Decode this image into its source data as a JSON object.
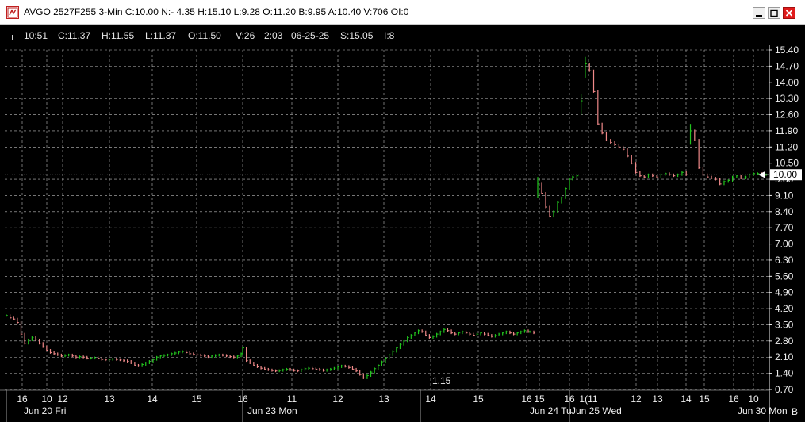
{
  "window": {
    "title": "AVGO 2527F255 3-Min C:10.00 N:- 4.35 H:15.10 L:9.28 O:11.20 B:9.95 A:10.40 V:706 OI:0",
    "icon": "chart-app-icon",
    "controls": [
      "minimize-icon",
      "maximize-icon",
      "close-icon"
    ]
  },
  "infobar": {
    "time": "10:51",
    "close": "C:11.37",
    "high": "H:11.55",
    "low": "L:11.37",
    "open": "O:11.50",
    "volume": "V:26",
    "bar_time": "2:03",
    "date": "06-25-25",
    "strike": "S:15.05",
    "index": "I:8"
  },
  "colors": {
    "background": "#000000",
    "grid": "#bdbdbd",
    "up": "#22c41e",
    "down": "#f08a8a",
    "text": "#f0f0f0",
    "price_box": "#ffffff"
  },
  "chart_data": {
    "type": "line",
    "title": "",
    "xlabel": "",
    "ylabel": "",
    "ylim": [
      0.7,
      15.4
    ],
    "y_ticks": [
      "15.40",
      "14.70",
      "14.00",
      "13.30",
      "12.60",
      "11.90",
      "11.20",
      "10.50",
      "9.80",
      "9.10",
      "8.40",
      "7.70",
      "7.00",
      "6.30",
      "5.60",
      "4.90",
      "4.20",
      "3.50",
      "2.80",
      "2.10",
      "1.40",
      "0.70"
    ],
    "current_price": "10.00",
    "low_label": "1.15",
    "x_tick_labels": [
      "16",
      "10",
      "12",
      "13",
      "14",
      "15",
      "16",
      "11",
      "12",
      "13",
      "14",
      "15",
      "16",
      "15",
      "16",
      "1(11",
      "12",
      "13",
      "14",
      "15",
      "16",
      "10"
    ],
    "date_labels": [
      "Jun 20 Fri",
      "Jun 23 Mon",
      "Jun 24 Tu",
      "Jun 25 Wed",
      "Jun 30 Mon"
    ],
    "corner_label": "B",
    "series": [
      {
        "values": [
          3.9,
          3.8,
          3.75,
          3.6,
          3.1,
          2.7,
          2.85,
          2.95,
          2.85,
          2.7,
          2.55,
          2.4,
          2.3,
          2.25,
          2.2,
          2.15,
          2.18,
          2.2,
          2.15,
          2.1,
          2.12,
          2.1,
          2.05,
          2.05,
          2.08,
          2.05,
          2.0,
          1.98,
          2.0,
          2.02,
          2.0,
          1.98,
          1.95,
          1.92,
          1.85,
          1.75,
          1.72,
          1.78,
          1.85,
          1.92,
          2.0,
          2.1,
          2.15,
          2.18,
          2.2,
          2.25,
          2.28,
          2.32,
          2.35,
          2.3,
          2.25,
          2.22,
          2.2,
          2.18,
          2.15,
          2.12,
          2.15,
          2.18,
          2.2,
          2.18,
          2.15,
          2.12,
          2.1,
          2.15,
          2.25,
          2.5,
          1.95,
          1.85,
          1.75,
          1.68,
          1.62,
          1.58,
          1.55,
          1.52,
          1.5,
          1.52,
          1.55,
          1.58,
          1.55,
          1.52,
          1.5,
          1.55,
          1.6,
          1.62,
          1.6,
          1.58,
          1.55,
          1.52,
          1.55,
          1.58,
          1.62,
          1.68,
          1.72,
          1.7,
          1.65,
          1.58,
          1.5,
          1.35,
          1.2,
          1.3,
          1.45,
          1.6,
          1.75,
          1.9,
          2.05,
          2.2,
          2.35,
          2.5,
          2.65,
          2.8,
          2.95,
          3.05,
          3.15,
          3.25,
          3.2,
          3.05,
          2.95,
          3.0,
          3.1,
          3.2,
          3.3,
          3.25,
          3.15,
          3.1,
          3.15,
          3.2,
          3.15,
          3.1,
          3.05,
          3.1,
          3.15,
          3.1,
          3.05,
          3.0,
          3.05,
          3.1,
          3.15,
          3.2,
          3.15,
          3.1,
          3.15,
          3.2,
          3.25,
          3.2,
          3.2,
          3.15,
          9.6,
          9.2,
          8.6,
          8.2,
          8.4,
          8.8,
          9.0,
          9.4,
          9.8,
          9.9,
          9.95,
          13.2,
          14.8,
          14.5,
          13.6,
          12.2,
          11.8,
          11.5,
          11.4,
          11.3,
          11.2,
          11.1,
          10.8,
          10.5,
          10.1,
          9.95,
          9.9,
          10.0,
          9.95,
          9.9,
          10.0,
          10.05,
          10.0,
          9.95,
          10.0,
          10.1,
          10.0,
          11.9,
          11.5,
          10.3,
          10.0,
          9.9,
          9.85,
          9.8,
          9.6,
          9.7,
          9.75,
          9.9,
          9.95,
          9.85,
          9.9,
          10.0,
          10.05,
          10.05,
          10.0,
          10.0
        ]
      }
    ]
  }
}
